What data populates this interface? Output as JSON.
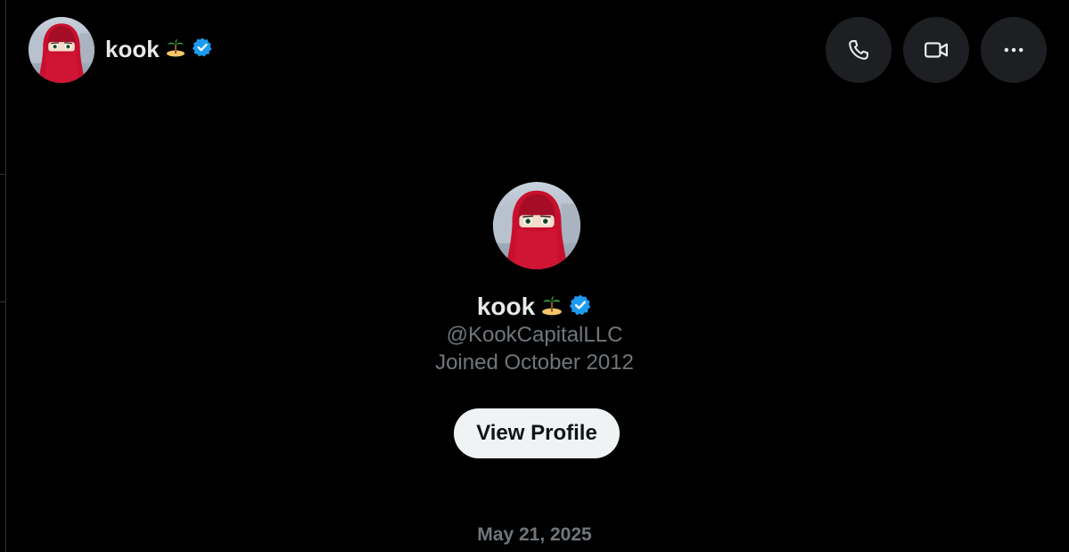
{
  "header": {
    "name": "kook",
    "name_emoji": "🏝",
    "verified_icon": "verified-badge-icon",
    "avatar_icon": "avatar-red-hijab-anime",
    "actions": [
      {
        "name": "call",
        "icon": "phone-icon"
      },
      {
        "name": "video",
        "icon": "video-camera-icon"
      },
      {
        "name": "more",
        "icon": "more-horizontal-icon"
      }
    ]
  },
  "profile": {
    "name": "kook",
    "name_emoji": "🏝",
    "handle": "@KookCapitalLLC",
    "joined": "Joined October 2012",
    "view_profile_label": "View Profile"
  },
  "conversation": {
    "date_divider": "May 21, 2025"
  },
  "colors": {
    "background": "#000000",
    "text_primary": "#e7e9ea",
    "text_secondary": "#71767b",
    "verified_blue": "#1d9bf0",
    "button_bg": "#1d1f23",
    "view_profile_bg": "#eff3f4"
  }
}
